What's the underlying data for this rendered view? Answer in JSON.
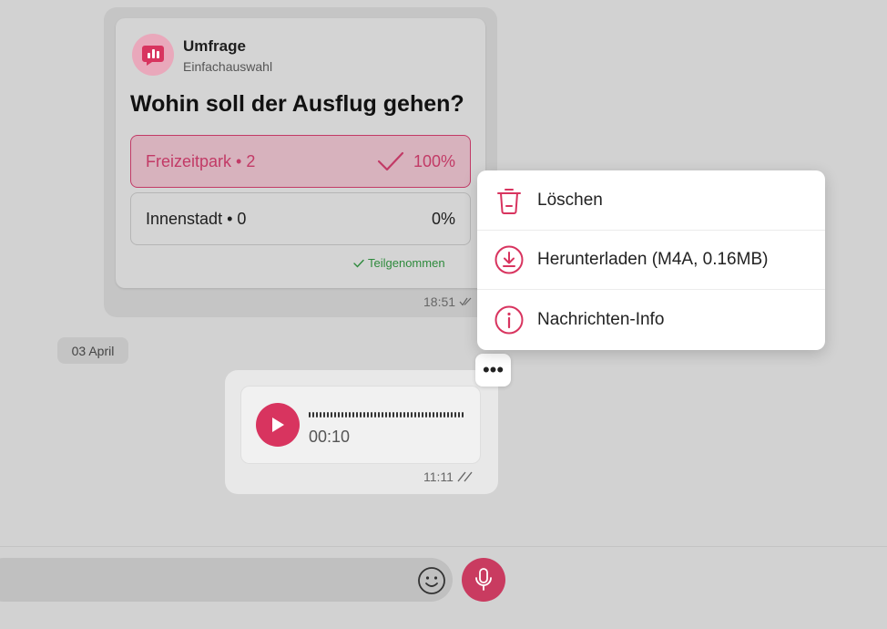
{
  "colors": {
    "accent": "#d8345f",
    "success": "#2e8a3c",
    "background": "#d2d2d2"
  },
  "poll": {
    "type_label": "Umfrage",
    "subtype_label": "Einfachauswahl",
    "question": "Wohin soll der Ausflug gehen?",
    "options": [
      {
        "label": "Freizeitpark • 2",
        "percent": "100%",
        "selected": true
      },
      {
        "label": "Innenstadt • 0",
        "percent": "0%",
        "selected": false
      }
    ],
    "participated_label": "Teilgenommen",
    "time": "18:51",
    "icon": "poll-chart-icon"
  },
  "date_separator": "03 April",
  "voice_message": {
    "duration": "00:10",
    "time": "11:11"
  },
  "more_button": {
    "label": "•••"
  },
  "context_menu": {
    "items": [
      {
        "label": "Löschen",
        "icon": "trash-icon"
      },
      {
        "label": "Herunterladen (M4A, 0.16MB)",
        "icon": "download-icon"
      },
      {
        "label": "Nachrichten-Info",
        "icon": "info-icon"
      }
    ]
  },
  "composer": {
    "emoji_icon": "emoji-icon",
    "mic_icon": "microphone-icon"
  }
}
